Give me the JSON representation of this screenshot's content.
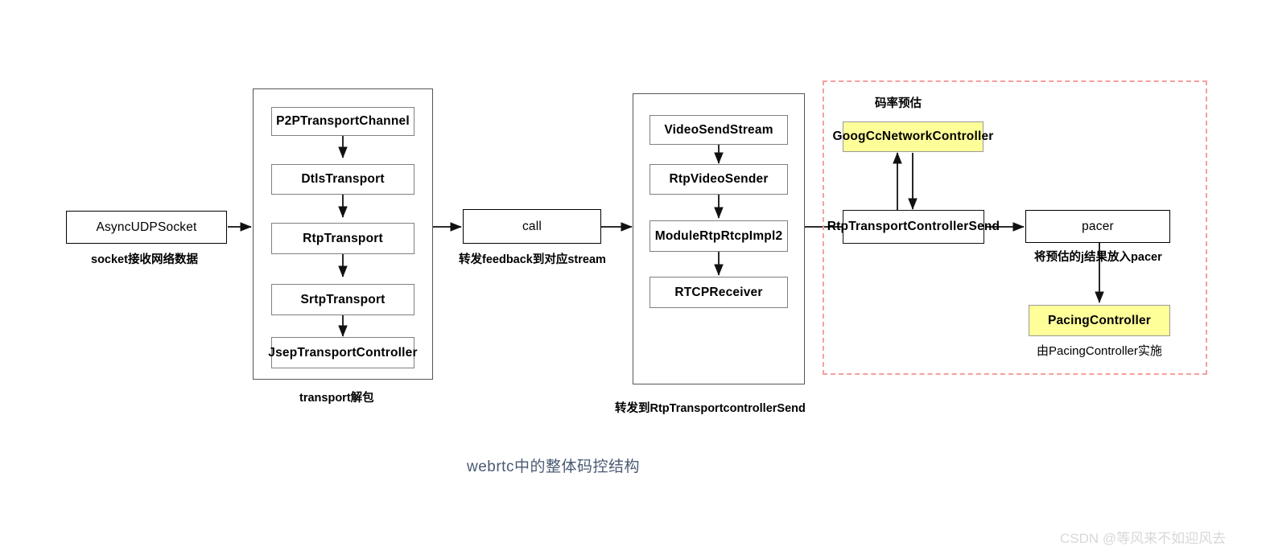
{
  "diagram": {
    "title": "webrtc中的整体码控结构",
    "watermark": "CSDN @等风来不如迎风去",
    "colors": {
      "highlight": "#ffff99",
      "node_border": "#808080",
      "dashed_region": "#f4a0a0",
      "title_text": "#4a5a73",
      "watermark_text": "#d8d8d8"
    },
    "nodes": {
      "async_udp_socket": "AsyncUDPSocket",
      "p2p_transport_channel": "P2PTransportChannel",
      "dtls_transport": "DtlsTransport",
      "rtp_transport": "RtpTransport",
      "srtp_transport": "SrtpTransport",
      "jsep_transport_controller": "JsepTransportController",
      "call": "call",
      "video_send_stream": "VideoSendStream",
      "rtp_video_sender": "RtpVideoSender",
      "module_rtp_rtcp_impl2": "ModuleRtpRtcpImpl2",
      "rtcp_receiver": "RTCPReceiver",
      "googcc_network_controller": "GoogCcNetworkController",
      "rtp_transport_controller_send": "RtpTransportControllerSend",
      "pacer": "pacer",
      "pacing_controller": "PacingController"
    },
    "captions": {
      "socket_recv": "socket接收网络数据",
      "transport_unpack": "transport解包",
      "forward_feedback": "转发feedback到对应stream",
      "forward_to_rtp_controller": "转发到RtpTransportcontrollerSend",
      "bitrate_estimation": "码率预估",
      "estimate_into_pacer": "将预估的j结果放入pacer",
      "implemented_by_pacing_controller": "由PacingController实施"
    }
  }
}
